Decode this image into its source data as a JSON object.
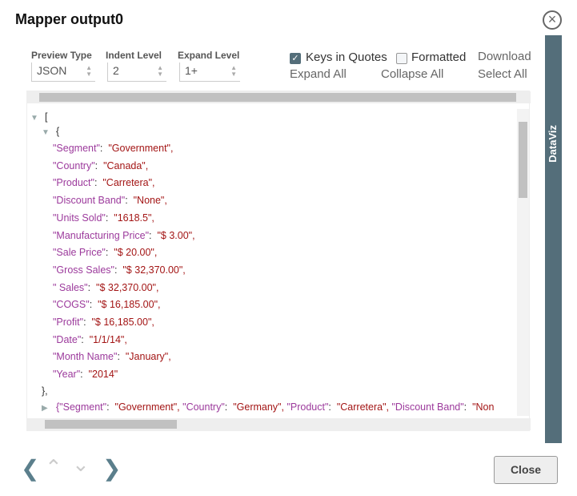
{
  "title": "Mapper output0",
  "controls": {
    "preview_type": {
      "label": "Preview Type",
      "value": "JSON"
    },
    "indent_level": {
      "label": "Indent Level",
      "value": "2"
    },
    "expand_level": {
      "label": "Expand Level",
      "value": "1+"
    },
    "keys_in_quotes": {
      "label": "Keys in Quotes",
      "checked": true
    },
    "formatted": {
      "label": "Formatted",
      "checked": false
    },
    "download": "Download",
    "expand_all": "Expand All",
    "collapse_all": "Collapse All",
    "select_all": "Select All"
  },
  "json": {
    "open_bracket": "[",
    "open_brace": "{",
    "fields": [
      {
        "key": "\"Segment\"",
        "value": "\"Government\","
      },
      {
        "key": "\"Country\"",
        "value": "\"Canada\","
      },
      {
        "key": "\"Product\"",
        "value": "\"Carretera\","
      },
      {
        "key": "\"Discount Band\"",
        "value": "\"None\","
      },
      {
        "key": "\"Units Sold\"",
        "value": "\"1618.5\","
      },
      {
        "key": "\"Manufacturing Price\"",
        "value": "\"$ 3.00\","
      },
      {
        "key": "\"Sale Price\"",
        "value": "\"$ 20.00\","
      },
      {
        "key": "\"Gross Sales\"",
        "value": "\"$ 32,370.00\","
      },
      {
        "key": "\" Sales\"",
        "value": "\"$ 32,370.00\","
      },
      {
        "key": "\"COGS\"",
        "value": "\"$ 16,185.00\","
      },
      {
        "key": "\"Profit\"",
        "value": "\"$ 16,185.00\","
      },
      {
        "key": "\"Date\"",
        "value": "\"1/1/14\","
      },
      {
        "key": "\"Month Name\"",
        "value": "\"January\","
      },
      {
        "key": "\"Year\"",
        "value": "\"2014\""
      }
    ],
    "close_brace": "},",
    "collapsed_row": [
      {
        "key": "{\"Segment\"",
        "value": "\"Government\","
      },
      {
        "key": "\"Country\"",
        "value": "\"Germany\","
      },
      {
        "key": "\"Product\"",
        "value": "\"Carretera\","
      },
      {
        "key": "\"Discount Band\"",
        "value": "\"Non"
      }
    ]
  },
  "sidebar": {
    "label": "DataViz",
    "color": "#546e7a"
  },
  "footer": {
    "close": "Close"
  },
  "colors": {
    "key": "#9c3a9c",
    "value": "#a31515"
  }
}
